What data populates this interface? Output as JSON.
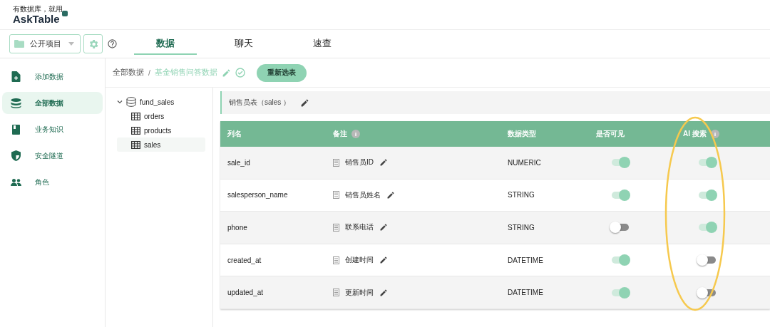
{
  "logo": {
    "tagline": "有数据库，就用",
    "name": "AskTable"
  },
  "project_select": {
    "value": "公开项目"
  },
  "top_tabs": [
    {
      "label": "数据",
      "selected": true
    },
    {
      "label": "聊天",
      "selected": false
    },
    {
      "label": "速查",
      "selected": false
    }
  ],
  "sidebar": {
    "items": [
      {
        "label": "添加数据",
        "selected": false
      },
      {
        "label": "全部数据",
        "selected": true
      },
      {
        "label": "业务知识",
        "selected": false
      },
      {
        "label": "安全隧道",
        "selected": false
      },
      {
        "label": "角色",
        "selected": false
      }
    ]
  },
  "breadcrumb": {
    "root": "全部数据",
    "separator": "/",
    "current": "基金销售问答数据"
  },
  "reselect_button": "重新选表",
  "tree": {
    "label": "fund_sales",
    "expanded": true,
    "children": [
      {
        "label": "orders",
        "selected": false
      },
      {
        "label": "products",
        "selected": false
      },
      {
        "label": "sales",
        "selected": true
      }
    ]
  },
  "table_title": "销售员表（sales ）",
  "table": {
    "columns": [
      {
        "label": "列名",
        "info": false
      },
      {
        "label": "备注",
        "info": true
      },
      {
        "label": "数据类型",
        "info": false
      },
      {
        "label": "是否可见",
        "info": false
      },
      {
        "label": "AI 搜索",
        "info": true
      }
    ],
    "rows": [
      {
        "name": "sale_id",
        "note": "销售员ID",
        "type": "NUMERIC",
        "visible": true,
        "ai_search": true
      },
      {
        "name": "salesperson_name",
        "note": "销售员姓名",
        "type": "STRING",
        "visible": true,
        "ai_search": true
      },
      {
        "name": "phone",
        "note": "联系电话",
        "type": "STRING",
        "visible": false,
        "ai_search": true
      },
      {
        "name": "created_at",
        "note": "创建时间",
        "type": "DATETIME",
        "visible": true,
        "ai_search": false
      },
      {
        "name": "updated_at",
        "note": "更新时间",
        "type": "DATETIME",
        "visible": true,
        "ai_search": false
      }
    ]
  }
}
